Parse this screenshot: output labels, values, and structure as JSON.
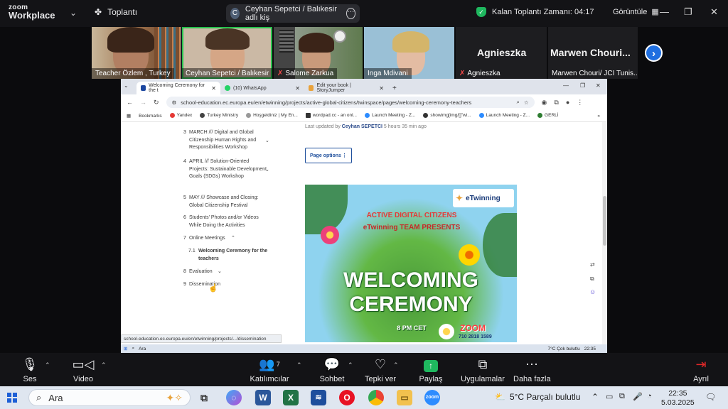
{
  "zoom": {
    "logo_line1": "zoom",
    "logo_line2": "Workplace",
    "meeting_label": "Toplantı",
    "share_avatar": "C",
    "share_title": "Ceyhan Sepetci / Balıkesir adlı kiş",
    "timer": "Kalan Toplantı Zamanı: 04:17",
    "view": "Görüntüle"
  },
  "participants": [
    {
      "name": "Teacher Özlem , Turkey",
      "muted": false
    },
    {
      "name": "Ceyhan Sepetci / Balıkesir",
      "muted": false
    },
    {
      "name": "Salome Zarkua",
      "muted": true
    },
    {
      "name": "Inga Mdivani",
      "muted": false
    },
    {
      "name": "Agnieszka",
      "muted": true,
      "display": "Agnieszka"
    },
    {
      "name": "Marwen Chouri/ JCI Tunis...",
      "muted": false,
      "display": "Marwen Chouri..."
    }
  ],
  "browser": {
    "tabs": [
      {
        "label": "Welcoming Ceremony for the t",
        "active": true
      },
      {
        "label": "(10) WhatsApp",
        "active": false
      },
      {
        "label": "Edit your book | StoryJumper",
        "active": false
      }
    ],
    "url": "school-education.ec.europa.eu/en/etwinning/projects/active-global-citizens/twinspace/pages/welcoming-ceremony-teachers",
    "bookmarks": [
      "Bookmarks",
      "Yandex",
      "Turkey Ministry",
      "Hoşgeldiniz | My En...",
      "wordpad.cc - an onl...",
      "Launch Meeting - Z...",
      "showimg[img/[]\"wi...",
      "Launch Meeting - Z...",
      "GERLİ"
    ],
    "status_url": "school-education.ec.europa.eu/en/etwinning/projects/.../dissemination"
  },
  "page": {
    "toc": [
      {
        "num": "3",
        "text": "MARCH /// Digital and Global Citizenship Human Rights and Responsibilities Workshop",
        "chev": "⌄"
      },
      {
        "num": "4",
        "text": "APRIL /// Solution-Oriented Projects: Sustainable Development Goals (SDGs) Workshop",
        "chev": "⌄"
      },
      {
        "num": "5",
        "text": "MAY /// Showcase and Closing: Global Citizenship Festival",
        "chev": ""
      },
      {
        "num": "6",
        "text": "Students' Photos and/or Videos While Doing the Activities",
        "chev": ""
      },
      {
        "num": "7",
        "text": "Online Meetings",
        "chev": "⌃"
      },
      {
        "num": "7.1",
        "text": "Welcoming Ceremony for the teachers",
        "chev": ""
      },
      {
        "num": "8",
        "text": "Evaluation",
        "chev": "⌄"
      },
      {
        "num": "9",
        "text": "Dissemination",
        "chev": ""
      }
    ],
    "last_updated_prefix": "Last updated by",
    "last_updated_author": "Ceyhan SEPETCI",
    "last_updated_suffix": "5 hours 35 min ago",
    "page_options": "Page options",
    "hero": {
      "brand": "eTwinning",
      "line1": "ACTIVE DIGITAL CITIZENS",
      "line2": "eTwinning TEAM PRESENTS",
      "title1": "WELCOMING",
      "title2": "CEREMONY",
      "time": "8 PM CET",
      "app": "ZOOM",
      "meeting_id": "710 2818 1589"
    }
  },
  "remote_taskbar": {
    "search": "Ara",
    "weather": "7°C Çok bulutlu",
    "time": "22:35"
  },
  "toolbar": {
    "audio": "Ses",
    "video": "Video",
    "participants": "Katılımcılar",
    "participants_count": "7",
    "chat": "Sohbet",
    "react": "Tepki ver",
    "share": "Paylaş",
    "apps": "Uygulamalar",
    "more": "Daha fazla",
    "leave": "Ayrıl"
  },
  "taskbar": {
    "search": "Ara",
    "weather": "5°C  Parçalı bulutlu",
    "time": "22:35",
    "date": "5.03.2025"
  }
}
